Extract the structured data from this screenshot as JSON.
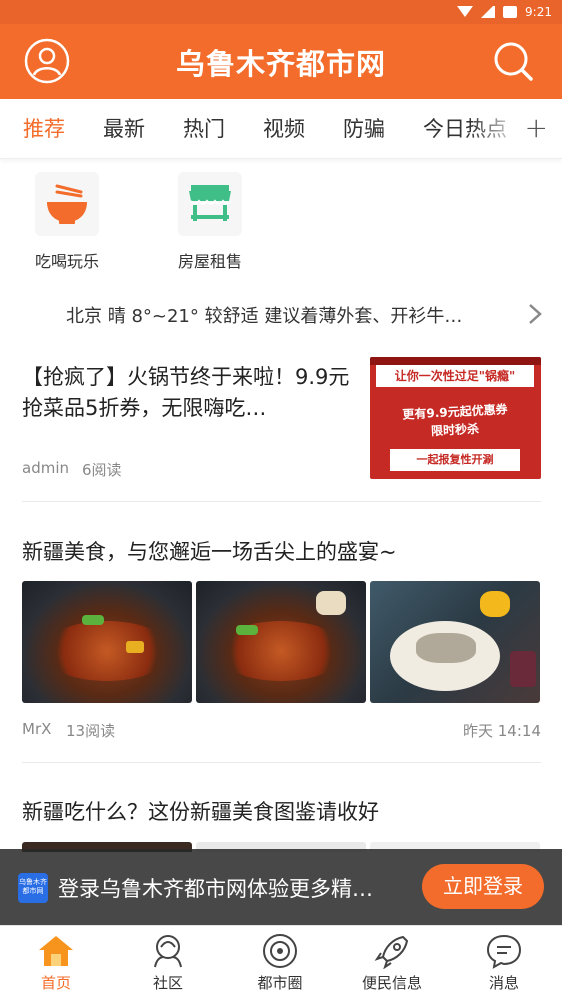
{
  "status_bar": {
    "time": "9:21"
  },
  "header": {
    "title": "乌鲁木齐都市网",
    "avatar_icon": "user-circle-icon",
    "search_icon": "search-icon"
  },
  "tabs": [
    {
      "label": "推荐",
      "active": true
    },
    {
      "label": "最新"
    },
    {
      "label": "热门"
    },
    {
      "label": "视频"
    },
    {
      "label": "防骗"
    },
    {
      "label": "今日热点"
    }
  ],
  "tab_add": "+",
  "categories": [
    {
      "label": "吃喝玩乐",
      "icon": "bowl-icon"
    },
    {
      "label": "房屋租售",
      "icon": "market-stall-icon"
    }
  ],
  "weather": {
    "text": "北京 晴 8°~21° 较舒适 建议着薄外套、开衫牛…"
  },
  "articles": [
    {
      "title": "【抢疯了】火锅节终于来啦！9.9元抢菜品5折券，无限嗨吃…",
      "author": "admin",
      "reads": "6阅读",
      "thumb": {
        "line1": "让你一次性过足\"锅瘾\"",
        "line2": "更有9.9元起优惠券",
        "line3": "限时秒杀",
        "line4": "一起报复性开涮"
      }
    },
    {
      "title": "新疆美食，与您邂逅一场舌尖上的盛宴~",
      "author": "MrX",
      "reads": "13阅读",
      "time": "昨天 14:14"
    },
    {
      "title": "新疆吃什么？这份新疆美食图鉴请收好"
    }
  ],
  "login_banner": {
    "logo_text": "乌鲁木齐都市网",
    "text": "登录乌鲁木齐都市网体验更多精…",
    "button": "立即登录"
  },
  "bottom_nav": [
    {
      "label": "首页",
      "icon": "home-icon",
      "active": true
    },
    {
      "label": "社区",
      "icon": "community-icon"
    },
    {
      "label": "都市圈",
      "icon": "city-circle-icon"
    },
    {
      "label": "便民信息",
      "icon": "rocket-icon"
    },
    {
      "label": "消息",
      "icon": "message-icon"
    }
  ],
  "colors": {
    "brand": "#f36c2b",
    "text": "#222222",
    "muted": "#888888"
  }
}
